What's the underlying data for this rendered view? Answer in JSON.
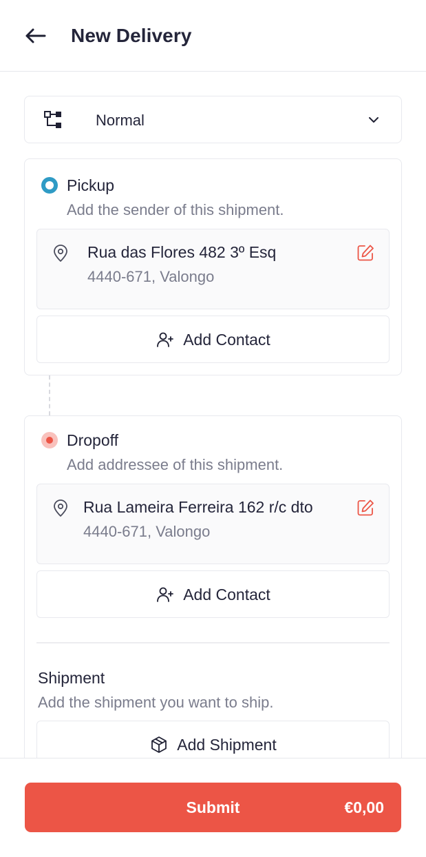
{
  "header": {
    "title": "New Delivery",
    "back_icon": "arrow-left-icon"
  },
  "delivery_type": {
    "selected": "Normal",
    "icon": "hierarchy-icon",
    "dropdown_icon": "chevron-down-icon"
  },
  "pickup": {
    "title": "Pickup",
    "subtitle": "Add the sender of this shipment.",
    "address_line1": "Rua das Flores 482 3º Esq",
    "address_line2": "4440-671, Valongo",
    "add_contact_label": "Add Contact",
    "status_color": "#2f9bc5"
  },
  "dropoff": {
    "title": "Dropoff",
    "subtitle": "Add addressee of this shipment.",
    "address_line1": "Rua Lameira Ferreira 162 r/c dto",
    "address_line2": "4440-671, Valongo",
    "add_contact_label": "Add Contact",
    "status_color": "#ec5546"
  },
  "shipment": {
    "title": "Shipment",
    "subtitle": "Add the shipment you want to ship.",
    "add_shipment_label": "Add Shipment"
  },
  "footer": {
    "submit_label": "Submit",
    "price": "€0,00",
    "accent_color": "#ec5546"
  }
}
